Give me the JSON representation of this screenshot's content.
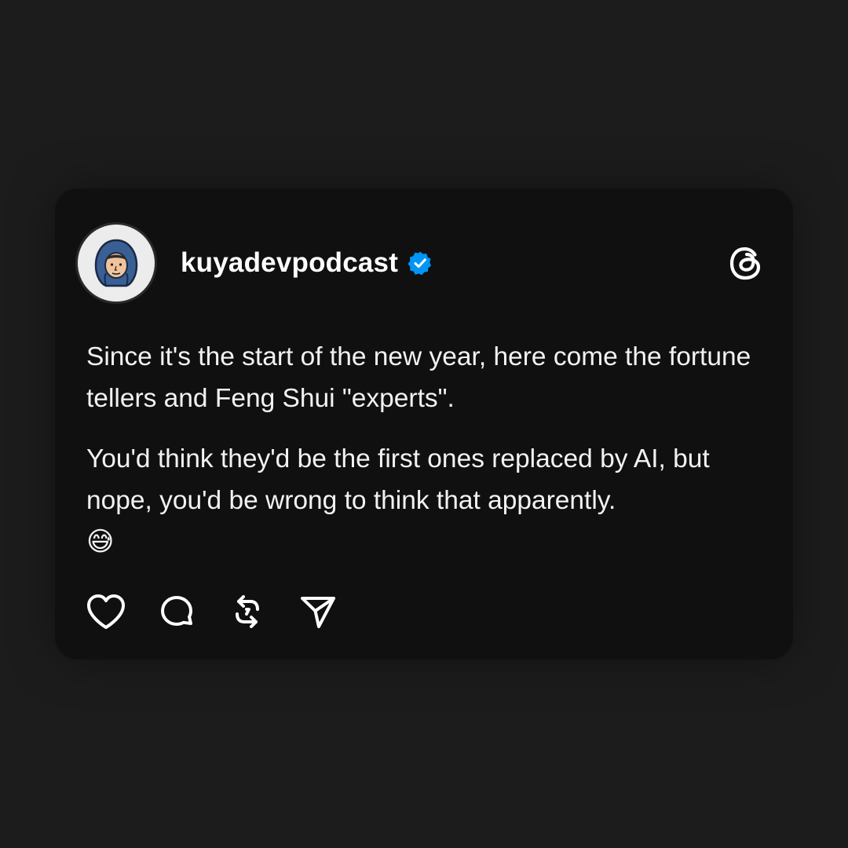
{
  "post": {
    "username": "kuyadevpodcast",
    "verified": true,
    "paragraphs": [
      "Since it's the start of the new year, here come the fortune tellers and Feng Shui \"experts\".",
      "You'd think they'd be the first ones replaced by AI, but nope, you'd be wrong to think that apparently."
    ],
    "emoji": "😅"
  },
  "icons": {
    "avatar": "hooded-developer-avatar-icon",
    "verified": "verified-badge-icon",
    "platform": "threads-logo-icon",
    "actions": [
      "heart-icon",
      "comment-icon",
      "repost-icon",
      "share-icon"
    ]
  },
  "colors": {
    "page_background": "#1c1c1c",
    "card_background": "#101010",
    "text": "#ffffff",
    "verified_blue": "#0095f6"
  }
}
